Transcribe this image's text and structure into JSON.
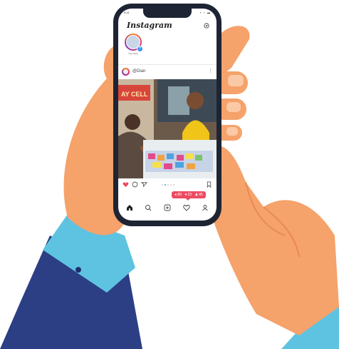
{
  "status_bar": {
    "time": "9:41",
    "icons": "▪ ◔ ▬"
  },
  "app": {
    "title": "Instagram",
    "direct_icon": "send-icon"
  },
  "story": {
    "label": "Your Story"
  },
  "post": {
    "username": "@Dian",
    "menu": "⋮",
    "shop_sign": "AY CELL",
    "carousel": {
      "count": 5,
      "active": 1
    }
  },
  "notifications": {
    "likes": "89",
    "comments": "23",
    "followers": "45"
  },
  "tabbar": [
    "home-icon",
    "search-icon",
    "add-post-icon",
    "activity-icon",
    "profile-icon"
  ],
  "colors": {
    "skin": "#f5a26b",
    "skin_shade": "#e98a52",
    "sleeve": "#2c3f85",
    "cuff": "#5ec3e0",
    "phone": "#1e2433",
    "like": "#ec4c63",
    "accent": "#3897f0"
  }
}
